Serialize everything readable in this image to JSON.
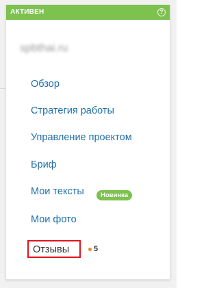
{
  "status": {
    "label": "АКТИВЕН",
    "help_icon": "help-icon",
    "help_glyph": "?"
  },
  "site": {
    "name": "spbthai.ru"
  },
  "menu": {
    "items": [
      {
        "label": "Обзор"
      },
      {
        "label": "Стратегия работы"
      },
      {
        "label": "Управление проектом"
      },
      {
        "label": "Бриф"
      },
      {
        "label": "Мои тексты",
        "badge": "Новинка"
      },
      {
        "label": "Мои фото"
      },
      {
        "label": "Отзывы",
        "count": "5"
      }
    ]
  },
  "colors": {
    "accent_green": "#7dc14f",
    "link_blue": "#1f6fa8",
    "highlight_red": "#e0141e",
    "dot_orange": "#f08a24"
  }
}
